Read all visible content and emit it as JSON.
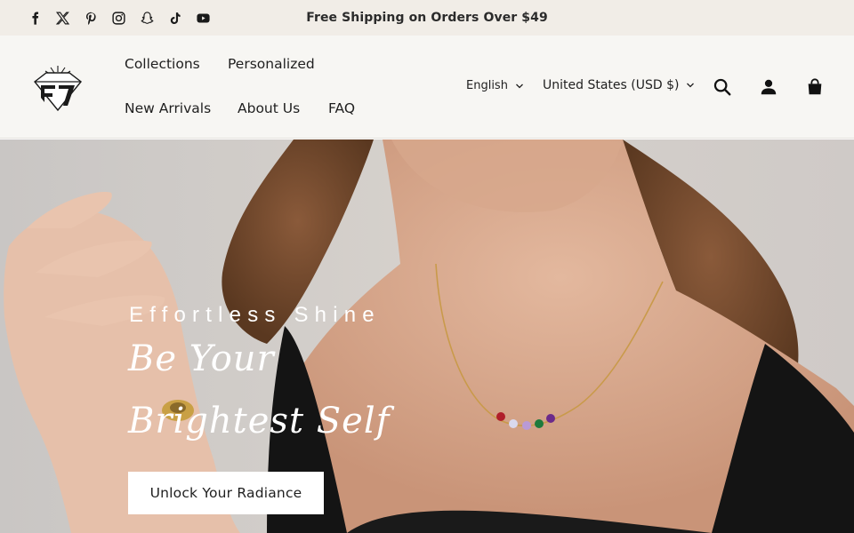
{
  "announcement": {
    "text": "Free Shipping on Orders Over $49",
    "socials": [
      "facebook-icon",
      "x-twitter-icon",
      "pinterest-icon",
      "instagram-icon",
      "snapchat-icon",
      "tiktok-icon",
      "youtube-icon"
    ]
  },
  "header": {
    "logo_icon": "diamond-monogram-logo",
    "nav": [
      "Collections",
      "Personalized",
      "New Arrivals",
      "About Us",
      "FAQ"
    ],
    "language": "English",
    "currency": "United States (USD $)",
    "icons": [
      "search-icon",
      "account-icon",
      "cart-icon"
    ]
  },
  "hero": {
    "eyebrow": "Effortless Shine",
    "headline_line1": "Be Your",
    "headline_line2": "Brightest Self",
    "cta_label": "Unlock Your Radiance"
  },
  "colors": {
    "announcement_bg": "#f1ede7",
    "header_bg": "#f7f6f3",
    "hero_bg": "#cfcac6",
    "text_dark": "#1f1f1f",
    "cta_bg": "#ffffff"
  }
}
